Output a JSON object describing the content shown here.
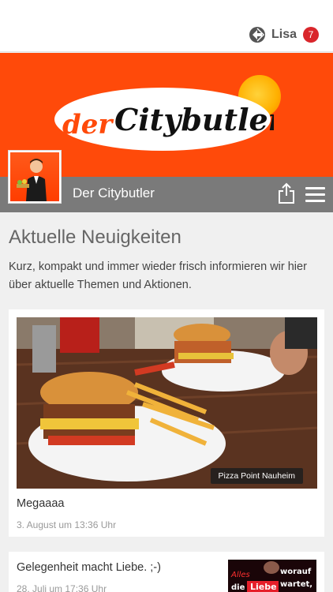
{
  "header": {
    "user_name": "Lisa",
    "notification_count": "7",
    "user_icon": "user-switch-icon"
  },
  "banner": {
    "logo_text_prefix": "der",
    "logo_text_main": "Citybutler",
    "brand_color": "#ff4a0a"
  },
  "titlebar": {
    "title": "Der Citybutler",
    "share_icon": "share-icon",
    "menu_icon": "menu-icon"
  },
  "section": {
    "title": "Aktuelle Neuigkeiten",
    "description": "Kurz, kompakt und immer wieder frisch informieren wir hier über aktuelle Themen und Aktionen."
  },
  "posts": [
    {
      "title": "Megaaaa",
      "date": "3. August um 13:36 Uhr",
      "image_caption": "Pizza Point Nauheim"
    },
    {
      "title": "Gelegenheit macht Liebe. ;-)",
      "date": "28. Juli um 17:36 Uhr",
      "thumb_text": [
        "Alles",
        "worauf",
        "die",
        "Liebe",
        "wartet,"
      ]
    }
  ]
}
